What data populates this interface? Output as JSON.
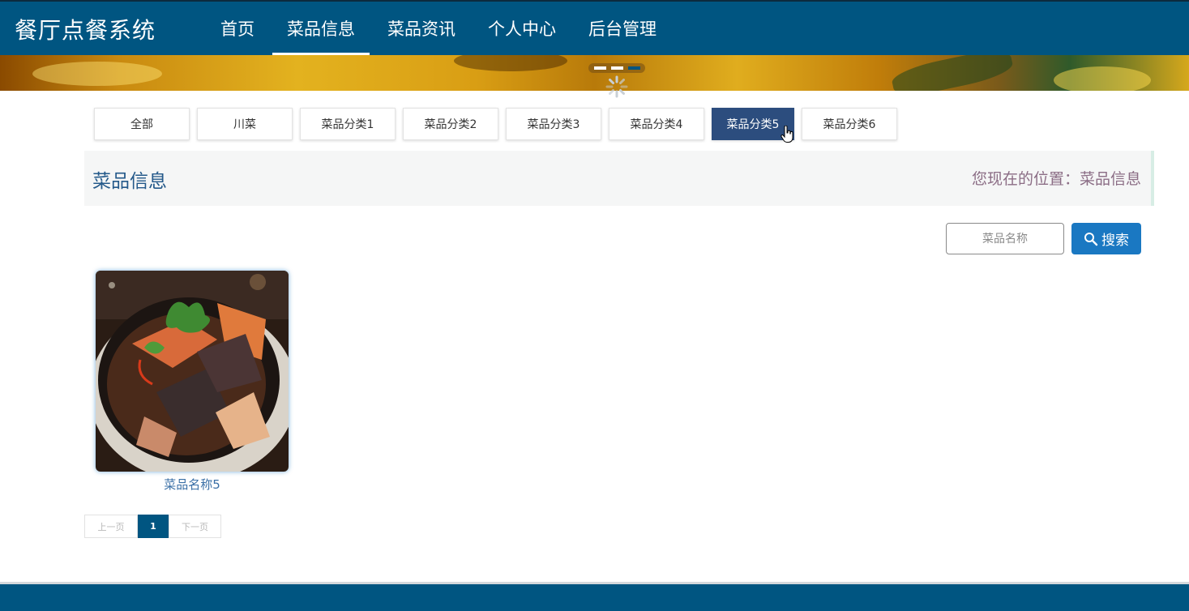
{
  "header": {
    "brand": "餐厅点餐系统",
    "nav": [
      "首页",
      "菜品信息",
      "菜品资讯",
      "个人中心",
      "后台管理"
    ],
    "active_nav": "菜品信息"
  },
  "banner": {
    "slide_count": 3,
    "active_slide": 3
  },
  "categories": {
    "items": [
      "全部",
      "川菜",
      "菜品分类1",
      "菜品分类2",
      "菜品分类3",
      "菜品分类4",
      "菜品分类5",
      "菜品分类6"
    ],
    "active": "菜品分类5"
  },
  "page": {
    "title": "菜品信息",
    "location": "您现在的位置：菜品信息"
  },
  "search": {
    "placeholder": "菜品名称",
    "value": "",
    "button_label": "搜索"
  },
  "products": [
    {
      "name": "菜品名称5"
    }
  ],
  "pagination": {
    "prev_label": "上一页",
    "current": "1",
    "next_label": "下一页"
  },
  "colors": {
    "primary": "#005581",
    "active_category": "#2c4d7e",
    "search_button": "#1a78c2",
    "title_text": "#24598a"
  }
}
